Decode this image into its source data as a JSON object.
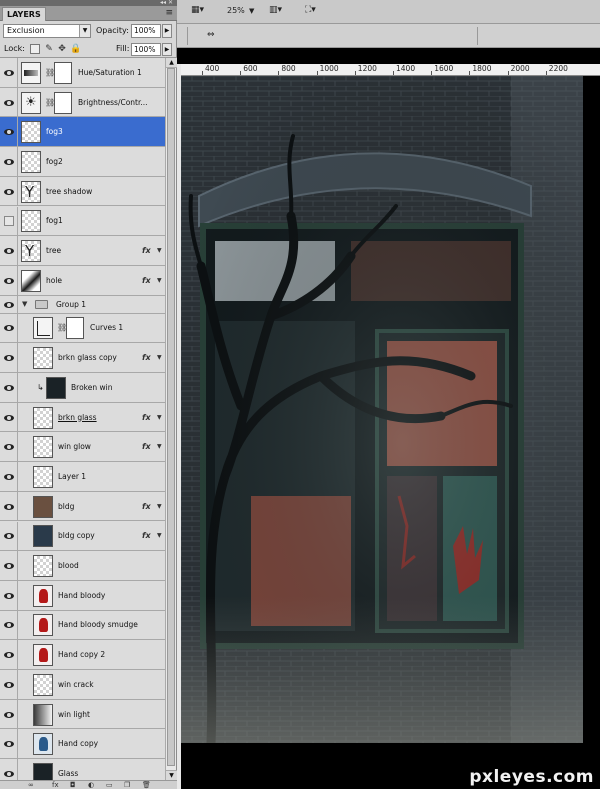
{
  "panel": {
    "tab_title": "LAYERS",
    "blend_mode": "Exclusion",
    "opacity_label": "Opacity:",
    "opacity_value": "100%",
    "lock_label": "Lock:",
    "fill_label": "Fill:",
    "fill_value": "100%"
  },
  "layers": [
    {
      "name": "Hue/Saturation 1",
      "visible": true,
      "thumb": "adj hue",
      "mask": true,
      "fx": false
    },
    {
      "name": "Brightness/Contr...",
      "visible": true,
      "thumb": "adj bright",
      "mask": true,
      "fx": false
    },
    {
      "name": "fog3",
      "visible": true,
      "thumb": "",
      "selected": true,
      "fx": false
    },
    {
      "name": "fog2",
      "visible": true,
      "thumb": "",
      "fx": false
    },
    {
      "name": "tree shadow",
      "visible": true,
      "thumb": "tree",
      "fx": false
    },
    {
      "name": "fog1",
      "visible": false,
      "thumb": "",
      "fx": false
    },
    {
      "name": "tree",
      "visible": true,
      "thumb": "tree",
      "fx": true
    },
    {
      "name": "hole",
      "visible": true,
      "thumb": "hole",
      "fx": true
    },
    {
      "name": "Group 1",
      "visible": true,
      "group": true
    },
    {
      "name": "Curves 1",
      "visible": true,
      "thumb": "adj curves",
      "mask": true,
      "indent": true,
      "fx": false
    },
    {
      "name": "brkn glass copy",
      "visible": true,
      "thumb": "",
      "indent": true,
      "fx": true
    },
    {
      "name": "Broken win",
      "visible": true,
      "thumb": "dark",
      "indent": true,
      "clipped": true,
      "fx": false
    },
    {
      "name": "brkn glass",
      "visible": true,
      "thumb": "",
      "indent": true,
      "underline": true,
      "fx": true
    },
    {
      "name": "win glow",
      "visible": true,
      "thumb": "",
      "indent": true,
      "fx": true
    },
    {
      "name": "Layer 1",
      "visible": true,
      "thumb": "",
      "indent": true,
      "fx": false
    },
    {
      "name": "bldg",
      "visible": true,
      "thumb": "bldg",
      "indent": true,
      "fx": true
    },
    {
      "name": "bldg copy",
      "visible": true,
      "thumb": "bldg2",
      "indent": true,
      "fx": true
    },
    {
      "name": "blood",
      "visible": true,
      "thumb": "",
      "indent": true,
      "fx": false
    },
    {
      "name": "Hand bloody",
      "visible": true,
      "thumb": "bloody",
      "indent": true,
      "fx": false
    },
    {
      "name": "Hand bloody smudge",
      "visible": true,
      "thumb": "bloody",
      "indent": true,
      "fx": false
    },
    {
      "name": "Hand copy 2",
      "visible": true,
      "thumb": "bloody",
      "indent": true,
      "fx": false
    },
    {
      "name": "win crack",
      "visible": true,
      "thumb": "",
      "indent": true,
      "fx": false
    },
    {
      "name": "win light",
      "visible": true,
      "thumb": "light",
      "indent": true,
      "fx": false
    },
    {
      "name": "Hand copy",
      "visible": true,
      "thumb": "blue",
      "indent": true,
      "fx": false
    },
    {
      "name": "Glass",
      "visible": true,
      "thumb": "dark",
      "indent": true,
      "fx": false
    }
  ],
  "fx_label": "fx",
  "toolbar": {
    "zoom": "25%"
  },
  "ruler": {
    "labels": [
      "400",
      "600",
      "800",
      "1000",
      "1200",
      "1400",
      "1600",
      "1800",
      "2000",
      "2200"
    ]
  },
  "watermark": "pxleyes.com",
  "colors": {
    "selection": "#3a6ccf",
    "panel_bg": "#dcdcdc"
  }
}
